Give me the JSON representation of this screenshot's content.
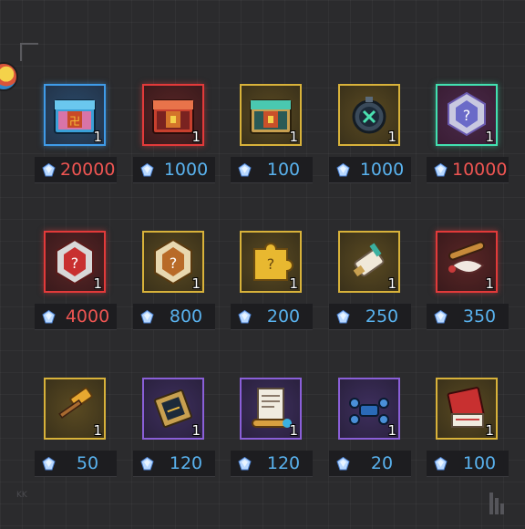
{
  "colors": {
    "price_red": "#ef5552",
    "price_blue": "#59b2ee",
    "background": "#2b2b2d"
  },
  "items": [
    {
      "icon": "blue-treasure-chest-icon",
      "frame": "blue",
      "qty": "1",
      "price": "20000",
      "price_color": "red"
    },
    {
      "icon": "red-treasure-chest-icon",
      "frame": "red",
      "qty": "1",
      "price": "1000",
      "price_color": "blue"
    },
    {
      "icon": "gold-treasure-chest-icon",
      "frame": "gold",
      "qty": "1",
      "price": "100",
      "price_color": "blue"
    },
    {
      "icon": "compass-orb-icon",
      "frame": "gold",
      "qty": "1",
      "price": "1000",
      "price_color": "blue"
    },
    {
      "icon": "mystery-emblem-icon",
      "frame": "teal",
      "qty": "1",
      "price": "10000",
      "price_color": "red"
    },
    {
      "icon": "red-mystery-badge-icon",
      "frame": "red",
      "qty": "1",
      "price": "4000",
      "price_color": "red"
    },
    {
      "icon": "bronze-mystery-badge-icon",
      "frame": "gold",
      "qty": "1",
      "price": "800",
      "price_color": "blue"
    },
    {
      "icon": "gold-mystery-puzzle-icon",
      "frame": "gold",
      "qty": "1",
      "price": "200",
      "price_color": "blue"
    },
    {
      "icon": "scroll-icon",
      "frame": "gold",
      "qty": "1",
      "price": "250",
      "price_color": "blue"
    },
    {
      "icon": "rolled-scroll-icon",
      "frame": "red",
      "qty": "1",
      "price": "350",
      "price_color": "blue"
    },
    {
      "icon": "hammer-icon",
      "frame": "gold",
      "qty": "1",
      "price": "50",
      "price_color": "blue"
    },
    {
      "icon": "blueprint-card-icon",
      "frame": "purple",
      "qty": "1",
      "price": "120",
      "price_color": "blue"
    },
    {
      "icon": "document-scroll-icon",
      "frame": "purple",
      "qty": "1",
      "price": "120",
      "price_color": "blue"
    },
    {
      "icon": "drone-icon",
      "frame": "purple",
      "qty": "1",
      "price": "20",
      "price_color": "blue"
    },
    {
      "icon": "red-book-icon",
      "frame": "gold",
      "qty": "1",
      "price": "100",
      "price_color": "blue"
    }
  ]
}
